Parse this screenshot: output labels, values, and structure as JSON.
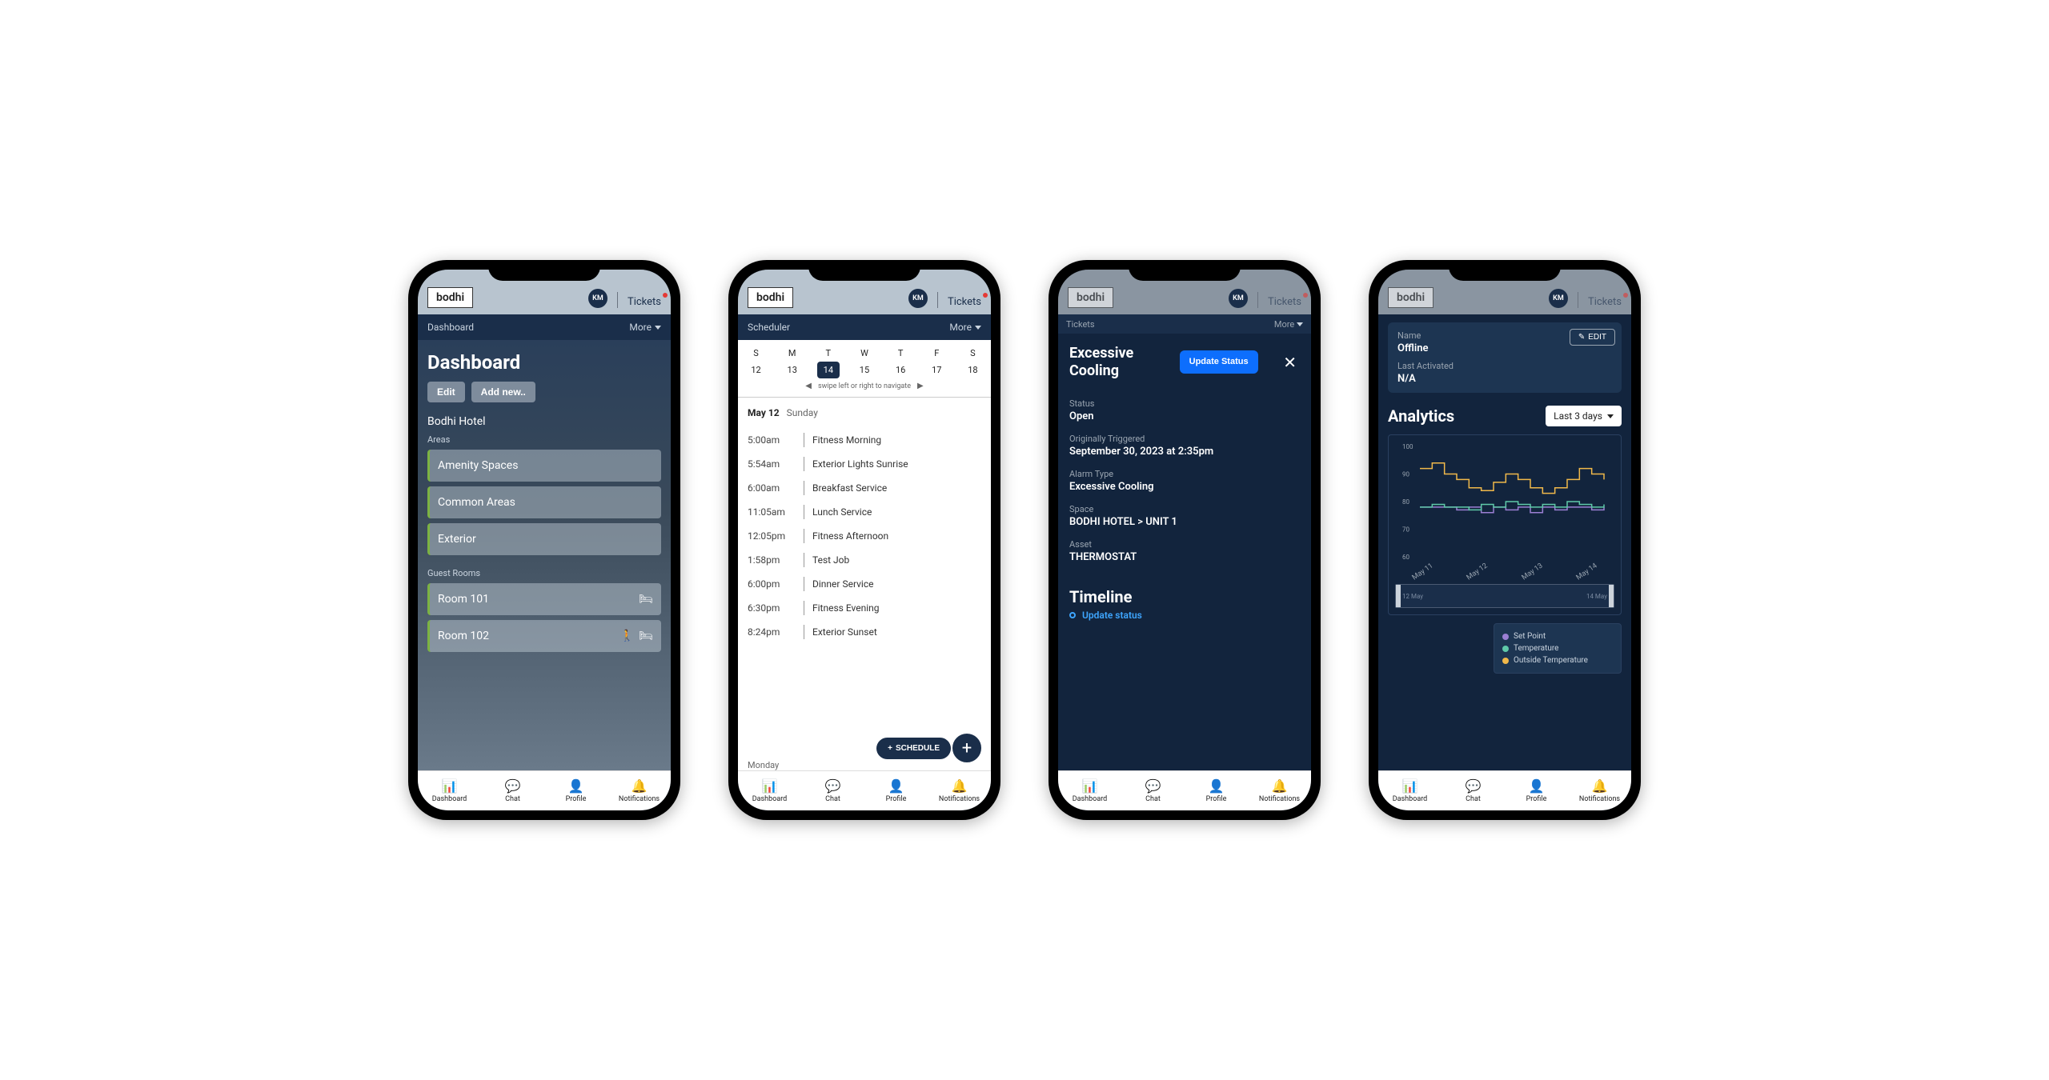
{
  "common": {
    "logo": "bodhi",
    "avatar": "KM",
    "tickets": "Tickets",
    "more": "More",
    "nav": [
      {
        "label": "Dashboard"
      },
      {
        "label": "Chat"
      },
      {
        "label": "Profile"
      },
      {
        "label": "Notifications"
      }
    ]
  },
  "screen1": {
    "crumb": "Dashboard",
    "title": "Dashboard",
    "edit": "Edit",
    "addnew": "Add new..",
    "hotel": "Bodhi Hotel",
    "areas_label": "Areas",
    "areas": [
      "Amenity Spaces",
      "Common Areas",
      "Exterior"
    ],
    "rooms_label": "Guest Rooms",
    "rooms": [
      "Room 101",
      "Room 102"
    ]
  },
  "screen2": {
    "crumb": "Scheduler",
    "days": [
      "S",
      "M",
      "T",
      "W",
      "T",
      "F",
      "S"
    ],
    "nums": [
      "12",
      "13",
      "14",
      "15",
      "16",
      "17",
      "18"
    ],
    "selected_idx": 2,
    "hint": "swipe left or right to navigate",
    "date": "May 12",
    "dayname": "Sunday",
    "events": [
      {
        "time": "5:00am",
        "title": "Fitness Morning"
      },
      {
        "time": "5:54am",
        "title": "Exterior Lights Sunrise"
      },
      {
        "time": "6:00am",
        "title": "Breakfast Service"
      },
      {
        "time": "11:05am",
        "title": "Lunch Service"
      },
      {
        "time": "12:05pm",
        "title": "Fitness Afternoon"
      },
      {
        "time": "1:58pm",
        "title": "Test Job"
      },
      {
        "time": "6:00pm",
        "title": "Dinner Service"
      },
      {
        "time": "6:30pm",
        "title": "Fitness Evening"
      },
      {
        "time": "8:24pm",
        "title": "Exterior Sunset"
      }
    ],
    "schedule_btn": "SCHEDULE",
    "next_day": "Monday"
  },
  "screen3": {
    "crumb": "Tickets",
    "title": "Excessive Cooling",
    "update": "Update Status",
    "fields": {
      "status_lbl": "Status",
      "status": "Open",
      "trigger_lbl": "Originally Triggered",
      "trigger": "September 30, 2023 at 2:35pm",
      "type_lbl": "Alarm Type",
      "type": "Excessive Cooling",
      "space_lbl": "Space",
      "space": "BODHI HOTEL > UNIT 1",
      "asset_lbl": "Asset",
      "asset": "THERMOSTAT"
    },
    "timeline": "Timeline",
    "timeline_action": "Update status"
  },
  "screen4": {
    "name_lbl": "Name",
    "name": "Offline",
    "last_lbl": "Last Activated",
    "last": "N/A",
    "edit": "EDIT",
    "analytics_title": "Analytics",
    "range": "Last 3 days",
    "xlabels": [
      "May 11",
      "May 12",
      "May 13",
      "May 14"
    ],
    "brush_left": "12 May",
    "brush_right": "14 May",
    "legend": [
      {
        "color": "#9b7fd4",
        "label": "Set Point"
      },
      {
        "color": "#5fc9a9",
        "label": "Temperature"
      },
      {
        "color": "#f0b84a",
        "label": "Outside Temperature"
      }
    ]
  },
  "chart_data": {
    "type": "line",
    "title": "",
    "xlabel": "",
    "ylabel": "",
    "ylim": [
      60,
      100
    ],
    "yticks": [
      60,
      70,
      80,
      90,
      100
    ],
    "x_categories": [
      "May 11",
      "May 12",
      "May 13",
      "May 14"
    ],
    "series": [
      {
        "name": "Set Point",
        "color": "#9b7fd4",
        "values": [
          78,
          78,
          78,
          77,
          78,
          76,
          78,
          77,
          78,
          76,
          78,
          77,
          78,
          78,
          77,
          78
        ]
      },
      {
        "name": "Temperature",
        "color": "#5fc9a9",
        "values": [
          78,
          79,
          78,
          78,
          77,
          79,
          78,
          80,
          79,
          78,
          79,
          78,
          80,
          79,
          78,
          79
        ]
      },
      {
        "name": "Outside Temperature",
        "color": "#f0b84a",
        "values": [
          92,
          94,
          90,
          88,
          85,
          84,
          87,
          90,
          88,
          85,
          83,
          85,
          88,
          92,
          90,
          88
        ]
      }
    ]
  }
}
